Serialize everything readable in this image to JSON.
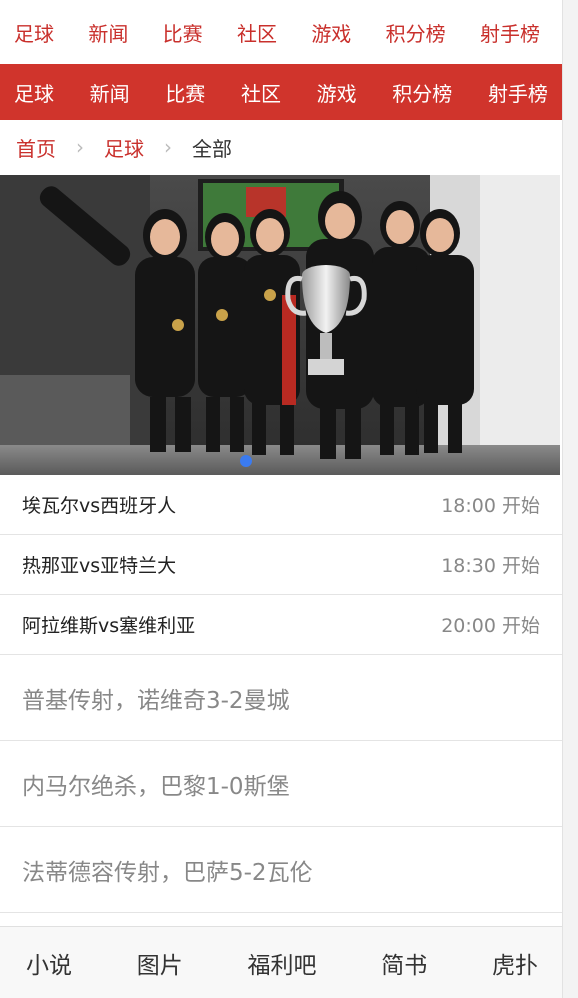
{
  "top_nav": {
    "items": [
      "足球",
      "新闻",
      "比赛",
      "社区",
      "游戏",
      "积分榜",
      "射手榜"
    ]
  },
  "red_nav": {
    "items": [
      "足球",
      "新闻",
      "比赛",
      "社区",
      "游戏",
      "积分榜",
      "射手榜"
    ],
    "color": "#d0342c"
  },
  "breadcrumb": {
    "home": "首页",
    "section": "足球",
    "current": "全部"
  },
  "banner": {
    "active_slide_indicator_color": "#3b7bf0"
  },
  "matches": [
    {
      "teams": "埃瓦尔vs西班牙人",
      "time": "18:00 开始"
    },
    {
      "teams": "热那亚vs亚特兰大",
      "time": "18:30 开始"
    },
    {
      "teams": "阿拉维斯vs塞维利亚",
      "time": "20:00 开始"
    }
  ],
  "news": [
    {
      "title": "普基传射，诺维奇3-2曼城"
    },
    {
      "title": "内马尔绝杀，巴黎1-0斯堡"
    },
    {
      "title": "法蒂德容传射，巴萨5-2瓦伦"
    }
  ],
  "bottom_nav": {
    "items": [
      "小说",
      "图片",
      "福利吧",
      "简书",
      "虎扑"
    ]
  }
}
